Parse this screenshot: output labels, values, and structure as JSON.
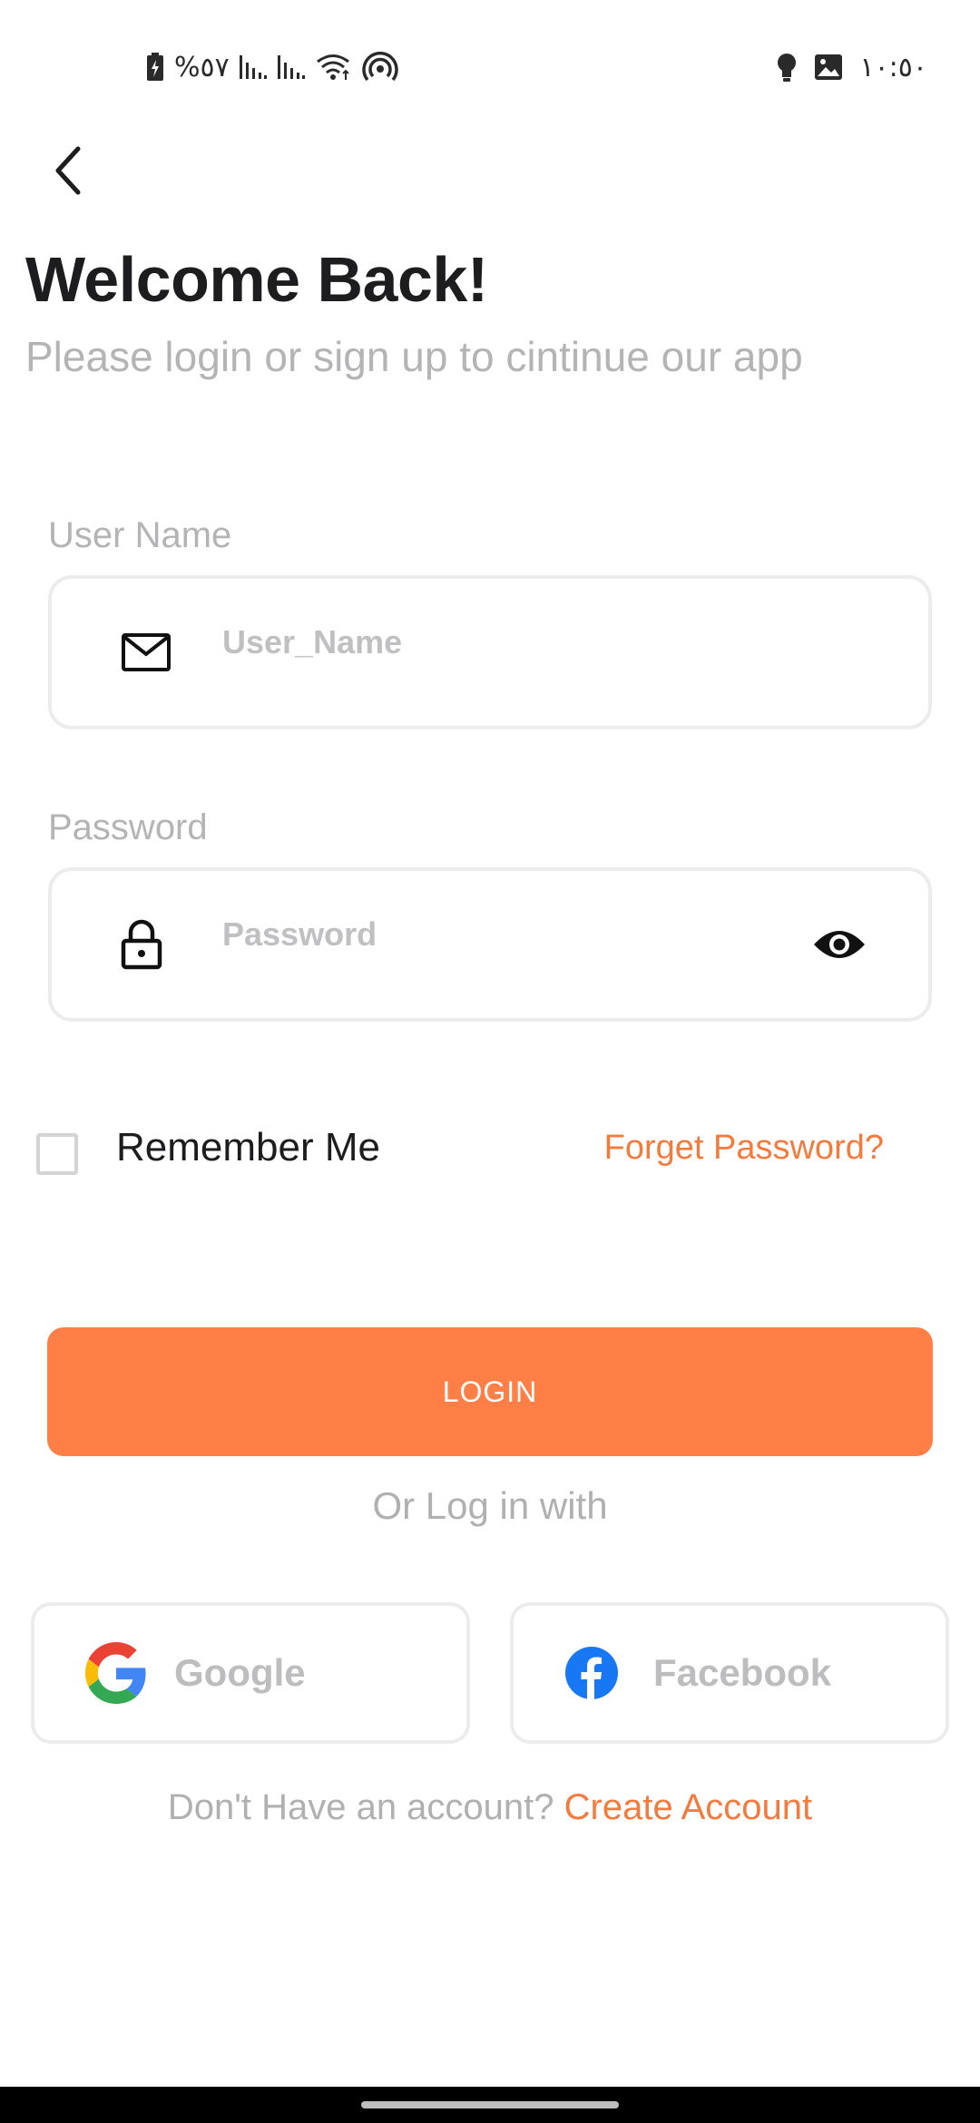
{
  "status_bar": {
    "battery_percent": "%٥٧",
    "time": "١٠:٥٠"
  },
  "header": {
    "title": "Welcome Back!",
    "subtitle": "Please login or sign up to cintinue our app"
  },
  "form": {
    "username": {
      "label": "User Name",
      "placeholder": "User_Name",
      "value": ""
    },
    "password": {
      "label": "Password",
      "placeholder": "Password",
      "value": ""
    },
    "remember_label": "Remember Me",
    "remember_checked": false,
    "forgot_label": "Forget Password?",
    "login_label": "LOGIN"
  },
  "social": {
    "divider_text": "Or Log in with",
    "google_label": "Google",
    "facebook_label": "Facebook"
  },
  "signup": {
    "prompt": "Don't Have an account? ",
    "link_label": "Create Account"
  },
  "icons": {
    "back": "arrow-left-icon",
    "mail": "mail-icon",
    "lock": "lock-icon",
    "eye": "eye-icon",
    "google": "google-logo-icon",
    "facebook": "facebook-logo-icon"
  },
  "colors": {
    "accent": "#ff7f47",
    "link": "#f47b3e",
    "muted": "#b4b4b6",
    "border": "#ececec",
    "facebook_blue": "#1877f2"
  }
}
